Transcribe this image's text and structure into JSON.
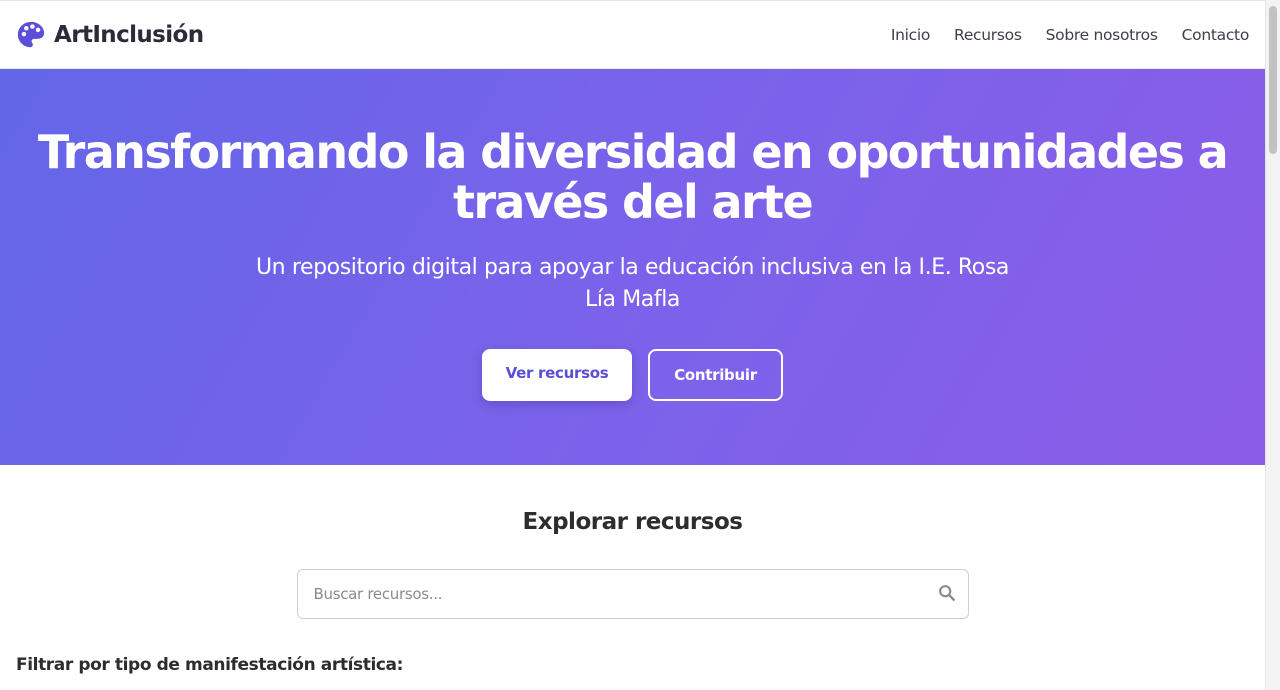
{
  "nav": {
    "brand": "ArtInclusión",
    "brand_icon": "palette-icon",
    "links": [
      "Inicio",
      "Recursos",
      "Sobre nosotros",
      "Contacto"
    ]
  },
  "hero": {
    "title": "Transformando la diversidad en oportunidades a través del arte",
    "subtitle": "Un repositorio digital para apoyar la educación inclusiva en la I.E. Rosa Lía Mafla",
    "primary_button": "Ver recursos",
    "secondary_button": "Contribuir",
    "gradient_start": "#6366e8",
    "gradient_end": "#8b5ce8"
  },
  "explore": {
    "title": "Explorar recursos",
    "search_placeholder": "Buscar recursos...",
    "search_icon": "search-icon",
    "filter_label": "Filtrar por tipo de manifestación artística:"
  },
  "colors": {
    "accent": "#5a4ed6",
    "text": "#2d2d2d"
  }
}
